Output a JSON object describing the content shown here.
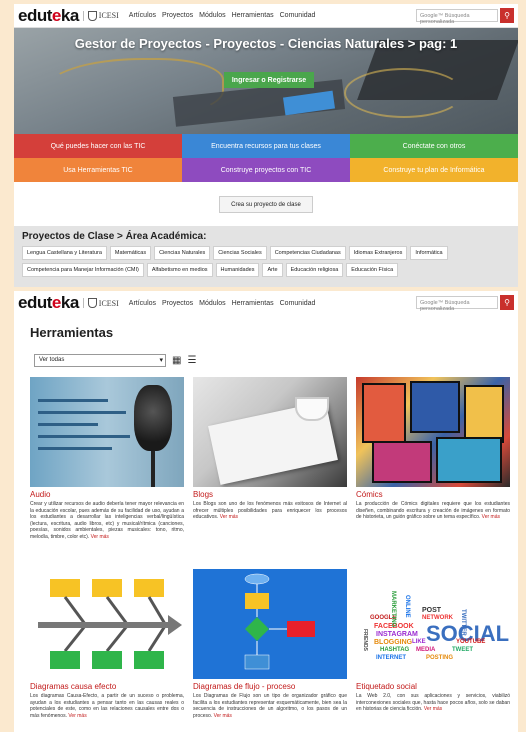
{
  "screen1": {
    "logo": {
      "text_a": "edut",
      "text_o": "e",
      "text_b": "ka"
    },
    "partner": "ICESI",
    "nav": [
      "Artículos",
      "Proyectos",
      "Módulos",
      "Herramientas",
      "Comunidad"
    ],
    "search_placeholder": "Google™ Búsqueda personalizada",
    "search_button_icon": "search-icon",
    "hero": {
      "title": "Gestor de Proyectos - Proyectos - Ciencias Naturales > pag: 1",
      "cta": "Ingresar o Registrarse"
    },
    "tiles": [
      {
        "label": "Qué puedes hacer con las TIC",
        "color": "#d43f3a"
      },
      {
        "label": "Encuentra recursos para tus clases",
        "color": "#3a87d6"
      },
      {
        "label": "Conéctate con otros",
        "color": "#4cae4c"
      },
      {
        "label": "Usa Herramientas TIC",
        "color": "#f0843b"
      },
      {
        "label": "Construye proyectos con TIC",
        "color": "#8e4bbf"
      },
      {
        "label": "Construye tu plan de Informática",
        "color": "#f2b22c"
      }
    ],
    "create_project_button": "Crea su proyecto de clase",
    "projects_section": {
      "title": "Proyectos de Clase > Área Académica:",
      "areas": [
        "Lengua Castellana y Literatura",
        "Matemáticas",
        "Ciencias Naturales",
        "Ciencias Sociales",
        "Competencias Ciudadanas",
        "Idiomas Extranjeros",
        "Informática",
        "Competencia para Manejar Información (CMI)",
        "Alfabetismo en medios",
        "Humanidades",
        "Arte",
        "Educación religiosa",
        "Educación Física"
      ]
    }
  },
  "screen2": {
    "logo": {
      "text_a": "edut",
      "text_o": "e",
      "text_b": "ka"
    },
    "partner": "ICESI",
    "nav": [
      "Artículos",
      "Proyectos",
      "Módulos",
      "Herramientas",
      "Comunidad"
    ],
    "search_placeholder": "Google™ Búsqueda personalizada",
    "page_title": "Herramientas",
    "filter_select_value": "Ver todas",
    "view_icons": [
      "grid-view-icon",
      "list-view-icon"
    ],
    "cards": [
      {
        "title": "Audio",
        "description": "Crear y utilizar recursos de audio debería tener mayor relevancia en la educación escolar, pues además de su facilidad de uso, ayudan a los estudiantes a desarrollar las inteligencias verbal/lingüística (lectura, escritura, audio libros, etc) y musical/rítmica (canciones, poesías, sonidos ambientales, piezas musicales: tono, ritmo, melodía, timbre, color etc).",
        "more": "Ver más"
      },
      {
        "title": "Blogs",
        "description": "Los Blogs son uno de los fenómenos más exitosos de Internet al ofrecer múltiples posibilidades para enriquecer los procesos educativos.",
        "more": "Ver más"
      },
      {
        "title": "Cómics",
        "description": "La producción de Cómics digitales requiere que los estudiantes diseñen, combinando escritura y creación de imágenes en formato de historieta, un guión gráfico sobre un tema específico.",
        "more": "Ver más"
      },
      {
        "title": "Diagramas causa efecto",
        "description": "Los diagramas Causa-Efecto, a partir de un suceso o problema, ayudan a los estudiantes a pensar tanto en las causas reales o potenciales de este, como en las relaciones causales entre dos o más fenómenos.",
        "more": "Ver más"
      },
      {
        "title": "Diagramas de flujo - proceso",
        "description": "Los Diagramas de Flujo son un tipo de organizador gráfico que facilita a los estudiantes representar esquemáticamente, bien sea la secuencia de instrucciones de un algoritmo, o los pasos de un proceso.",
        "more": "Ver más"
      },
      {
        "title": "Etiquetado social",
        "description": "La Web 2.0, con sus aplicaciones y servicios, viabilizó interconexiones sociales que, hasta hace pocos años, solo se daban en historias de ciencia ficción.",
        "more": "Ver más"
      }
    ],
    "social_cloud": [
      "SOCIAL",
      "FACEBOOK",
      "INSTAGRAM",
      "BLOGGING",
      "HASHTAG",
      "INTERNET",
      "MEDIA",
      "TWEET",
      "POST",
      "NETWORK",
      "GOOGLE",
      "POSTING",
      "MARKETING",
      "ONLINE",
      "LIKE",
      "FRIENDS",
      "TWITTER",
      "YOUTUBE"
    ]
  }
}
